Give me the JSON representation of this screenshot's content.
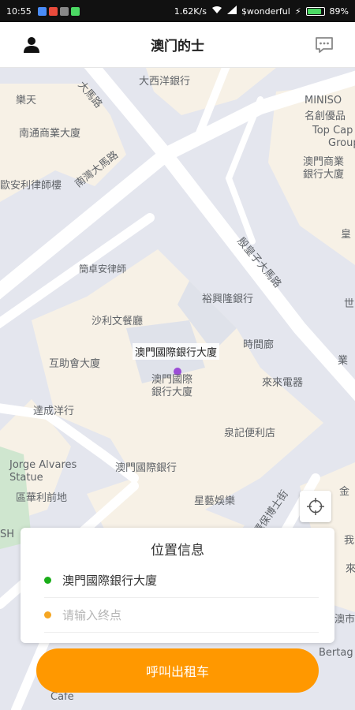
{
  "status_bar": {
    "time": "10:55",
    "speed": "1.62K/s",
    "carrier": "$wonderful",
    "battery": "89%",
    "battery_level": 0.89
  },
  "header": {
    "title": "澳门的士",
    "user_icon": "user-icon",
    "message_icon": "message-icon"
  },
  "map": {
    "labels": {
      "l1": "大西洋銀行",
      "l2": "樂天",
      "l3": "南通商業大廈",
      "l4": "歐安利律師樓",
      "l5": "南灣大馬路",
      "l6": "MINISO",
      "l7": "名創優品",
      "l8": "Top Cap",
      "l9": "Group",
      "l10": "澳門商業",
      "l11": "銀行大廈",
      "l12": "殷皇子大馬路",
      "l13": "簡卓安律師",
      "l14": "裕興隆銀行",
      "l15": "沙利文餐廳",
      "l16": "澳門國際銀行大廈",
      "l17": "時間廊",
      "l18": "互助會大廈",
      "l19": "澳門國際",
      "l20": "銀行大廈",
      "l21": "來來電器",
      "l22": "達成洋行",
      "l23": "泉記便利店",
      "l24": "Jorge Alvares",
      "l25": "Statue",
      "l26": "澳門國際銀行",
      "l27": "區華利前地",
      "l28": "星藝娛樂",
      "l29": "羅保博士街",
      "l30": "金",
      "l31": "皇",
      "l32": "世",
      "l33": "業",
      "l34": "SH",
      "l35": "我",
      "l36": "來",
      "l37": "澳市",
      "l38": "Bertag",
      "l39": "Cafe",
      "l40": "大馬路"
    }
  },
  "location": {
    "title": "位置信息",
    "from": "澳門國際銀行大廈",
    "to_placeholder": "请输入终点"
  },
  "call_button": "呼叫出租车",
  "colors": {
    "accent": "#ff9800",
    "from_dot": "#1aad19",
    "to_dot": "#f5a623"
  }
}
